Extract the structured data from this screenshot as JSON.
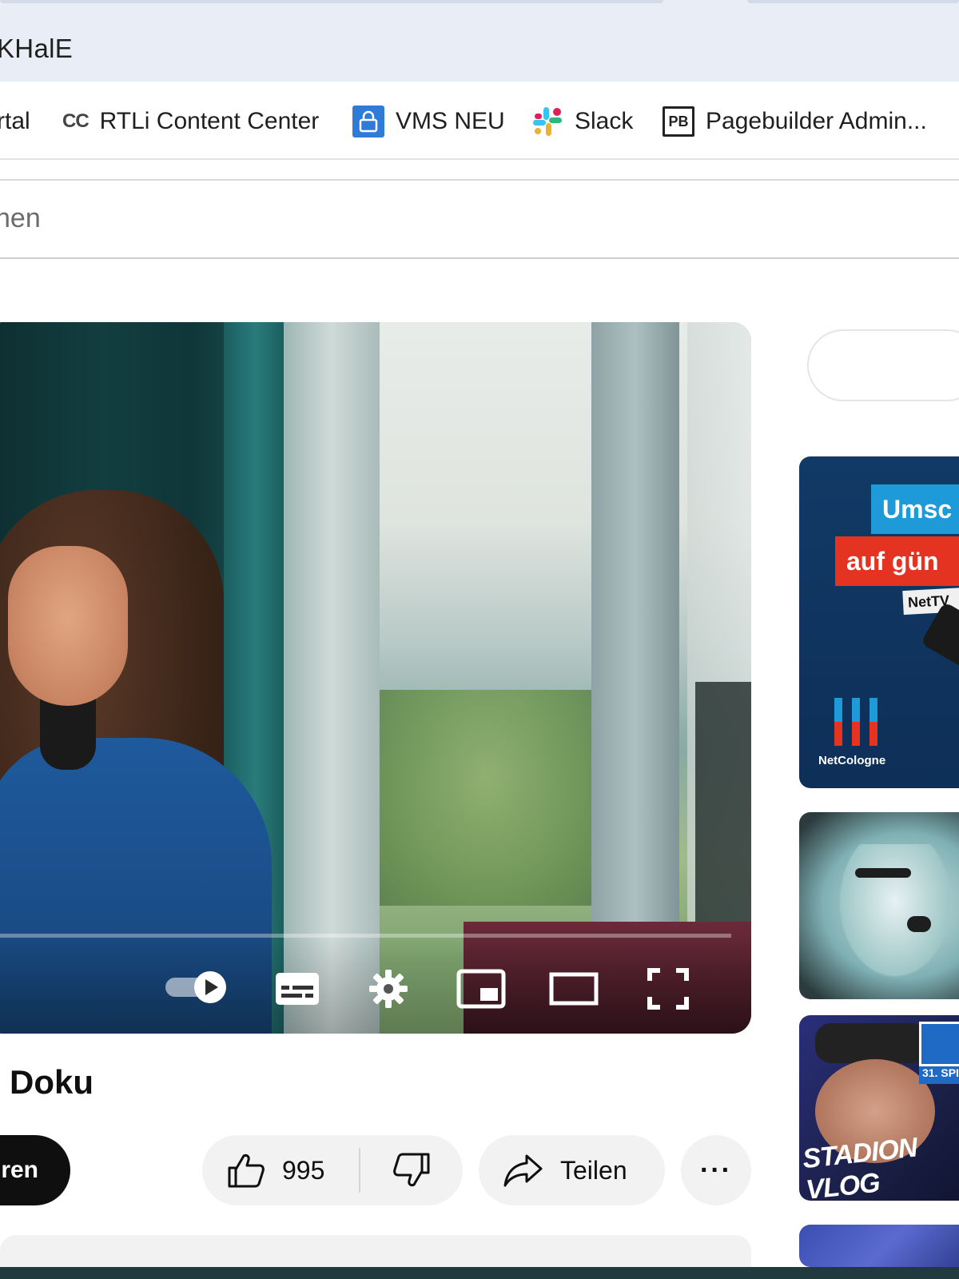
{
  "browser": {
    "address": "KHalE",
    "bookmarks": [
      {
        "label": "rtal",
        "icon": "none"
      },
      {
        "label": "RTLi Content Center",
        "icon": "cc-icon",
        "icon_text": "CC"
      },
      {
        "label": "VMS NEU",
        "icon": "lock-icon"
      },
      {
        "label": "Slack",
        "icon": "slack-icon"
      },
      {
        "label": "Pagebuilder Admin...",
        "icon": "pb-icon",
        "icon_text": "[PB]"
      }
    ]
  },
  "search": {
    "visible_text": "hen"
  },
  "player": {
    "progress_fraction": 0.0,
    "controls": [
      "autoplay-toggle",
      "subtitles",
      "settings",
      "miniplayer",
      "theater-mode",
      "fullscreen"
    ]
  },
  "video": {
    "title_visible": "Doku",
    "subscribe_label": "ren",
    "like_count": "995",
    "share_label": "Teilen",
    "more_label": "···"
  },
  "sidebar": {
    "ad": {
      "line1": "Umsc",
      "line2": "auf gün",
      "tag": "NetTV",
      "brand": "NetCologne",
      "colors": {
        "blue": "#1e9ad8",
        "red": "#e53322",
        "bg": "#0d2f58"
      }
    },
    "thumb3": {
      "badge_text": "31. SPI",
      "graffiti": "STADION VLOG"
    }
  },
  "colors": {
    "accent_red": "#ff0000",
    "chip_bg": "#f2f2f2",
    "subscribe_bg": "#0f0f0f"
  }
}
